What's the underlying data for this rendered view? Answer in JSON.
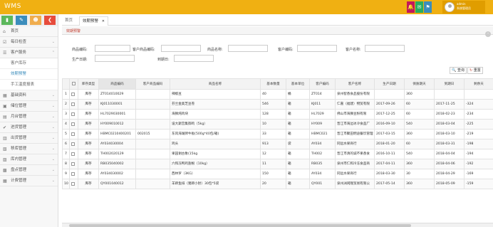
{
  "app": {
    "title": "WMS"
  },
  "topbar": {
    "buttons": [
      {
        "icon": "bell-icon",
        "glyph": "🔔",
        "color": "#c2185b"
      },
      {
        "icon": "envelope-icon",
        "glyph": "✉",
        "color": "#27ae60"
      },
      {
        "icon": "flag-icon",
        "glyph": "⚑",
        "color": "#3c8dbc"
      }
    ],
    "user": {
      "line1": "admin",
      "line2": "系统管理员"
    }
  },
  "quick_buttons": [
    {
      "icon": "chart-icon",
      "glyph": "▮",
      "color": "#5cb85c"
    },
    {
      "icon": "pencil-icon",
      "glyph": "✎",
      "color": "#3c8dbc"
    },
    {
      "icon": "users-icon",
      "glyph": "☻",
      "color": "#f0ad4e"
    },
    {
      "icon": "share-icon",
      "glyph": "❮",
      "color": "#e74c3c"
    }
  ],
  "sidebar": {
    "items": [
      {
        "label": "首页",
        "icon": "home-icon",
        "glyph": "⌂",
        "arrow": ""
      },
      {
        "label": "每日检查",
        "icon": "check-icon",
        "glyph": "☑",
        "arrow": "⌄"
      },
      {
        "label": "客户服务",
        "icon": "service-icon",
        "glyph": "☰",
        "arrow": "⌃",
        "expanded": true
      },
      {
        "label": "基础资料",
        "icon": "database-icon",
        "glyph": "▦",
        "arrow": "⌄"
      },
      {
        "label": "储位管理",
        "icon": "location-icon",
        "glyph": "▣",
        "arrow": "⌄"
      },
      {
        "label": "月台管理",
        "icon": "dock-icon",
        "glyph": "▤",
        "arrow": "⌄"
      },
      {
        "label": "进货管理",
        "icon": "inbound-icon",
        "glyph": "✔",
        "arrow": "⌄"
      },
      {
        "label": "出货管理",
        "icon": "outbound-icon",
        "glyph": "▥",
        "arrow": "⌄"
      },
      {
        "label": "移库管理",
        "icon": "move-icon",
        "glyph": "▧",
        "arrow": "⌄"
      },
      {
        "label": "库内管理",
        "icon": "inventory-icon",
        "glyph": "▨",
        "arrow": "⌄"
      },
      {
        "label": "盘点管理",
        "icon": "count-icon",
        "glyph": "▩",
        "arrow": "⌄"
      },
      {
        "label": "计费管理",
        "icon": "billing-icon",
        "glyph": "▦",
        "arrow": "⌄"
      }
    ],
    "subitems": [
      {
        "label": "客户库存",
        "active": false
      },
      {
        "label": "效期预警",
        "active": true
      },
      {
        "label": "手工温度报表",
        "active": false
      }
    ]
  },
  "tabs": [
    {
      "label": "首页",
      "active": false
    },
    {
      "label": "效期预警",
      "active": true,
      "close": "✕"
    }
  ],
  "panel": {
    "title": "效期预警"
  },
  "filters": {
    "row1": [
      {
        "label": "商品编码:"
      },
      {
        "label": "客户商品编码:"
      },
      {
        "label": "商品名称:"
      },
      {
        "label": "客户编码:"
      },
      {
        "label": "客户名称:"
      }
    ],
    "row2": [
      {
        "label": "生产日期:"
      },
      {
        "label": "到期日:"
      }
    ]
  },
  "actions": {
    "search": "查询",
    "reset": "重置",
    "search_glyph": "🔍",
    "reset_glyph": "↻"
  },
  "table": {
    "headers": [
      "",
      "",
      "库存类型",
      "商品编码",
      "客户商品编码",
      "商品名称",
      "基本数量",
      "基本单位",
      "客户编码",
      "客户名称",
      "生产日期",
      "保质期天",
      "到期日",
      "剩余天"
    ],
    "rows": [
      [
        "1",
        "",
        "库存",
        "ZT014010029",
        "",
        "辣椒豆",
        "40",
        "桶",
        "ZT014",
        "泉州智香食品股份有限",
        "",
        "360",
        "",
        ""
      ],
      [
        "2",
        "",
        "库存",
        "KJ011030001",
        "",
        "芬兰金奥芝豆卷",
        "546",
        "箱",
        "KJ011",
        "仁嘉（福建）物贸有限",
        "2017-09-26",
        "60",
        "2017-11-25",
        "-324"
      ],
      [
        "3",
        "",
        "库存",
        "HL7029030001",
        "",
        "海狮炖鸡块",
        "128",
        "箱",
        "HL7029",
        "佛山市海狮豆粉有限",
        "2017-12-25",
        "60",
        "2018-02-23",
        "-234"
      ],
      [
        "4",
        "",
        "库存",
        "HY009010012",
        "",
        "设大斯宫集御鸡（5kg）",
        "10",
        "箱",
        "HY009",
        "晋江市海边冰冷食品厂",
        "2016-09-10",
        "540",
        "2018-03-04",
        "-225"
      ],
      [
        "5",
        "",
        "库存",
        "HBMC0210400201",
        "002015",
        "东风海湖牌牛板(500g*40包/箱)",
        "33",
        "箱",
        "HBMC021",
        "晋江市聚田明迪餐饮管理",
        "2017-03-15",
        "360",
        "2018-03-10",
        "-219"
      ],
      [
        "6",
        "",
        "库存",
        "AY034030004",
        "",
        "鸡头",
        "913",
        "袋",
        "AY034",
        "同远水果商行",
        "2018-01-20",
        "60",
        "2018-03-31",
        "-198"
      ],
      [
        "7",
        "",
        "库存",
        "TH002020129",
        "",
        "果园谢古象(15kg",
        "12",
        "箱",
        "TH002",
        "晋江市清的诚不果香食",
        "2016-10-11",
        "540",
        "2018-04-04",
        "-194"
      ],
      [
        "8",
        "",
        "库存",
        "RB035040002",
        "",
        "六和冻鸭鸡翅根（10kg）",
        "11",
        "箱",
        "RB035",
        "泉州市仁和冷冻食品商",
        "2017-04-11",
        "360",
        "2018-04-06",
        "-192"
      ],
      [
        "9",
        "",
        "库存",
        "AY034030002",
        "",
        "西林罗（3KG）",
        "150",
        "箱",
        "AY034",
        "同远水果商行",
        "2018-03-30",
        "30",
        "2018-04-29",
        "-169"
      ],
      [
        "10",
        "",
        "库存",
        "QY001040012",
        "",
        "羊蹄鱼排（猪蹄小肘）30包*5袋",
        "20",
        "箱",
        "QY001",
        "泉州洲闲隆贸易有限公",
        "2017-05-14",
        "360",
        "2018-05-09",
        "-159"
      ]
    ]
  }
}
